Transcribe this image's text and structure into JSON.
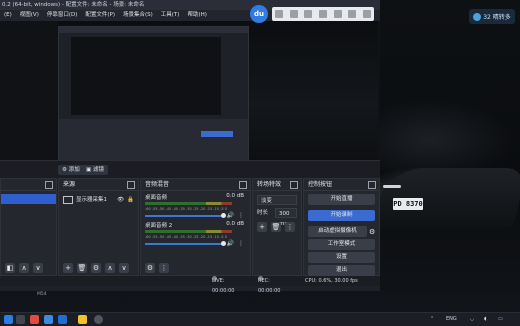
{
  "window": {
    "title": "0.2 (64-bit, windows) - 配置文件: 未命名 - 场景: 未命名",
    "menu": [
      "(E)",
      "视图(V)",
      "停靠窗口(D)",
      "配置文件(P)",
      "场景集合(S)",
      "工具(T)",
      "帮助(H)"
    ]
  },
  "desktop": {
    "plate_text": "PD 8370",
    "weather_text": "32 晴转多"
  },
  "preview_bar": {
    "add_label": "添加",
    "filter_label": "滤镜"
  },
  "docks": {
    "scenes": {
      "title": ""
    },
    "sources": {
      "title": "来源",
      "items": [
        {
          "name": "显示器采集1"
        }
      ]
    },
    "mixer": {
      "title": "音频混音",
      "channels": [
        {
          "name": "桌面音频",
          "db": "0.0 dB"
        },
        {
          "name": "桌面音频 2",
          "db": "0.0 dB"
        }
      ],
      "scale_text": "-60 -55 -50 -45 -40 -35 -30 -25 -20 -15 -10 -5 0"
    },
    "transitions": {
      "title": "转场特效",
      "selected": "淡变",
      "duration_label": "时长",
      "duration_value": "300 ms"
    },
    "controls": {
      "title": "控制按钮",
      "buttons": [
        "开始直播",
        "开始录制",
        "启动虚拟摄像机",
        "工作室模式",
        "设置",
        "退出"
      ]
    }
  },
  "status": {
    "live": "LIVE: 00:00:00",
    "rec": "REC: 00:00:00",
    "cpu": "CPU: 0.6%, 30.00 fps"
  },
  "taskbar": {
    "lang": "ENG",
    "corner_label": "M54"
  },
  "colors": {
    "accent": "#3b6ad1",
    "panel": "#25272f",
    "window_bg": "#1f2128"
  }
}
